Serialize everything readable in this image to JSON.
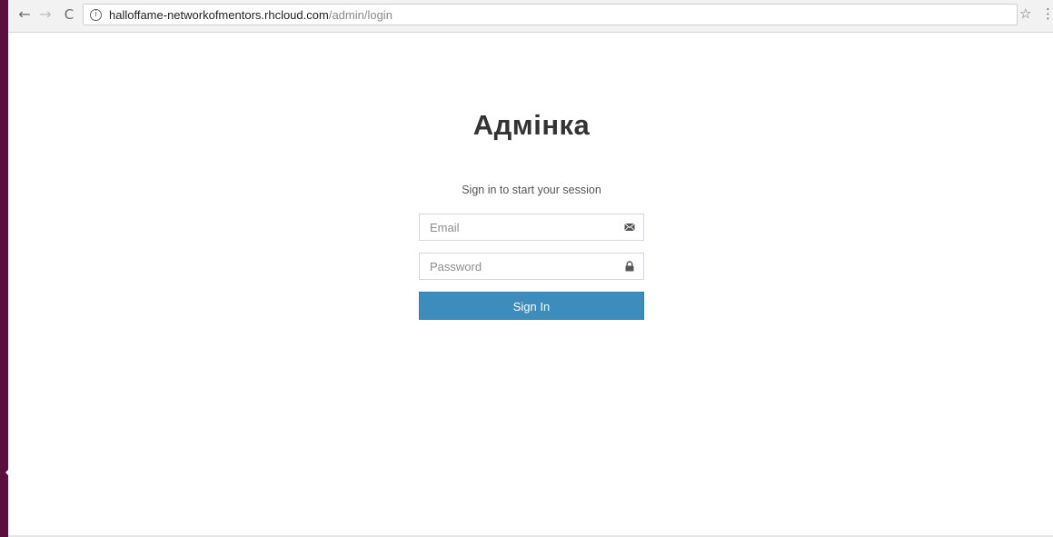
{
  "browser": {
    "back_icon": "←",
    "forward_icon": "→",
    "reload_icon": "C",
    "info_icon": "i",
    "url_host": "halloffame-networkofmentors.rhcloud.com",
    "url_path": "/admin/login",
    "star_icon": "☆",
    "menu_icon": "⋮"
  },
  "login": {
    "title": "Адмінка",
    "subtitle": "Sign in to start your session",
    "email_placeholder": "Email",
    "password_placeholder": "Password",
    "signin_label": "Sign In"
  },
  "colors": {
    "sidebar_strip": "#5a0f3c",
    "button": "#3c8dbc",
    "input_border": "#d2d6de"
  }
}
